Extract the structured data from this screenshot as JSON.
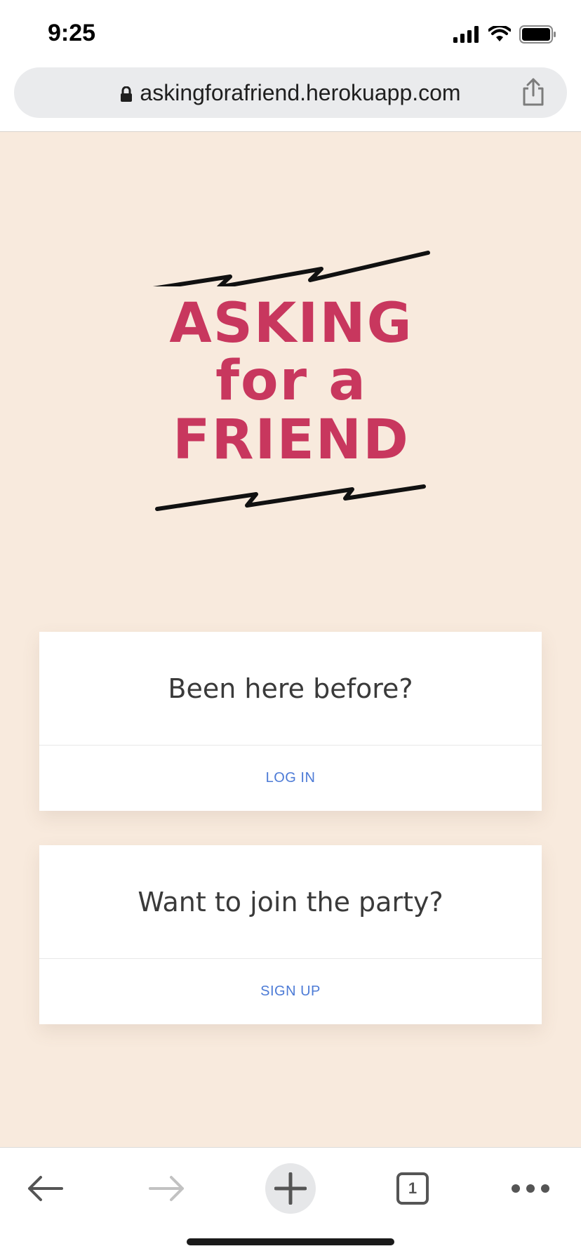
{
  "status_bar": {
    "time": "9:25"
  },
  "browser": {
    "url": "askingforafriend.herokuapp.com",
    "tab_count": "1"
  },
  "logo": {
    "line1": "ASKING",
    "line2": "for a",
    "line3": "FRIEND"
  },
  "cards": {
    "login": {
      "heading": "Been here before?",
      "action": "LOG IN"
    },
    "signup": {
      "heading": "Want to join the party?",
      "action": "SIGN UP"
    }
  },
  "colors": {
    "page_bg": "#f8eadd",
    "logo": "#c8375e",
    "link": "#4d7bd6"
  },
  "icons": {
    "back": "arrow-left-icon",
    "forward": "arrow-right-icon",
    "new_tab": "plus-icon",
    "tabs": "tab-count-icon",
    "menu": "more-icon"
  }
}
